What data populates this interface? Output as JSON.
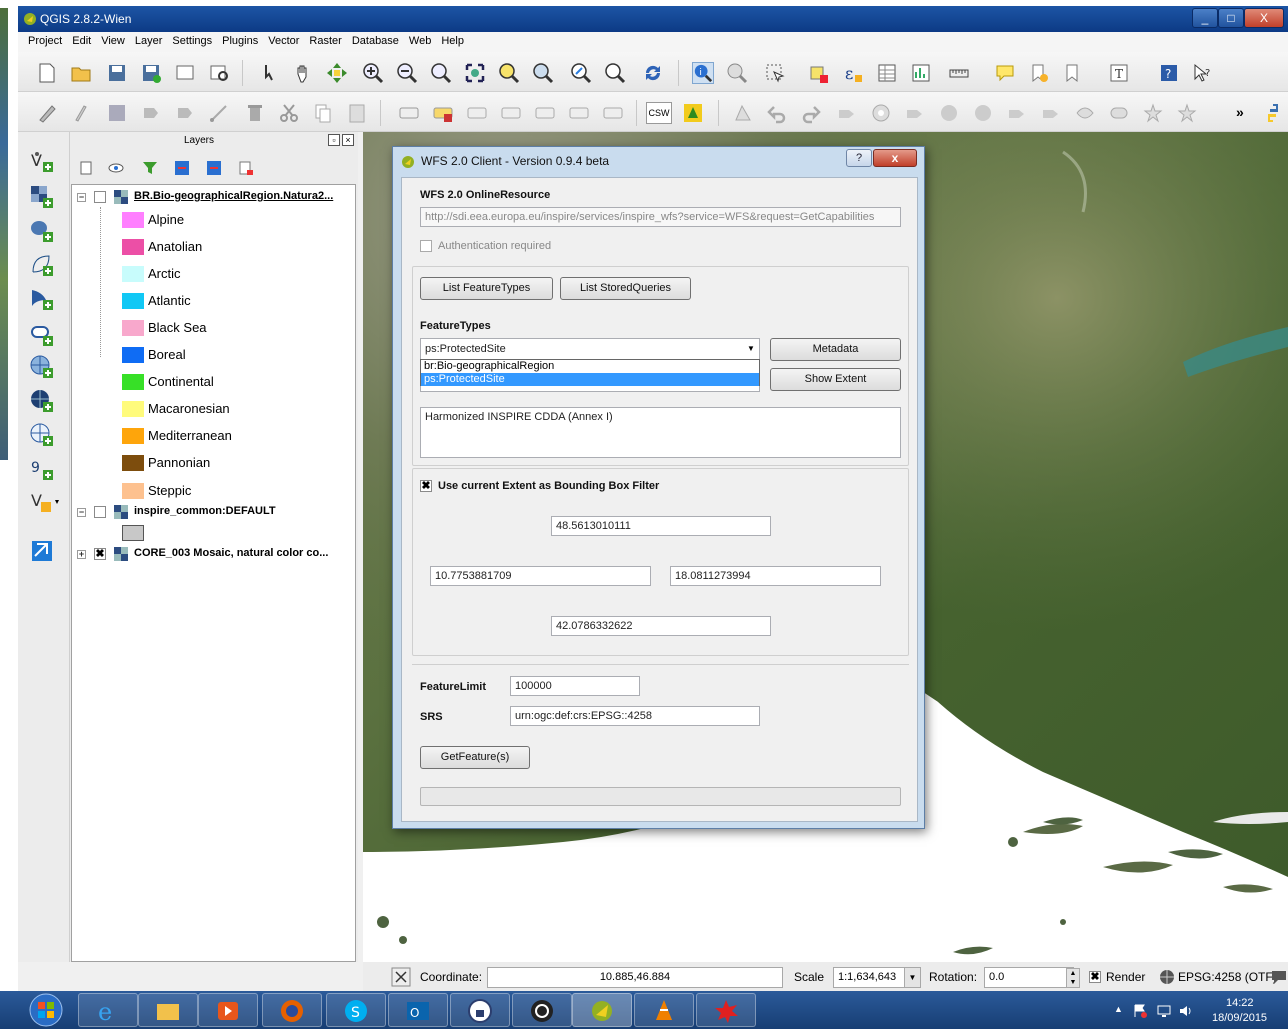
{
  "window": {
    "title": "QGIS 2.8.2-Wien",
    "min": "_",
    "max": "□",
    "close": "X"
  },
  "menu": [
    "Project",
    "Edit",
    "View",
    "Layer",
    "Settings",
    "Plugins",
    "Vector",
    "Raster",
    "Database",
    "Web",
    "Help"
  ],
  "toolbar2": {
    "csw_label": "CSW",
    "more": "»"
  },
  "layers": {
    "title": "Layers",
    "float_btn": "▫",
    "close_btn": "×",
    "groups": [
      {
        "name": "BR.Bio-geographicalRegion.Natura2...",
        "checked": false,
        "classes": [
          {
            "label": "Alpine",
            "color": "#ff7fff"
          },
          {
            "label": "Anatolian",
            "color": "#ec4fa6"
          },
          {
            "label": "Arctic",
            "color": "#c8fcfc"
          },
          {
            "label": "Atlantic",
            "color": "#11c8f5"
          },
          {
            "label": "Black Sea",
            "color": "#f8a8cc"
          },
          {
            "label": "Boreal",
            "color": "#0f6cf4"
          },
          {
            "label": "Continental",
            "color": "#37e027"
          },
          {
            "label": "Macaronesian",
            "color": "#fffb7c"
          },
          {
            "label": "Mediterranean",
            "color": "#fea50b"
          },
          {
            "label": "Pannonian",
            "color": "#7d4d0d"
          },
          {
            "label": "Steppic",
            "color": "#fdc18f"
          }
        ]
      },
      {
        "name": "inspire_common:DEFAULT",
        "checked": false,
        "classes": [
          {
            "label": "",
            "color": "#c8c8c8"
          }
        ]
      },
      {
        "name": "CORE_003 Mosaic, natural color co...",
        "checked": true
      }
    ]
  },
  "dialog": {
    "title": "WFS 2.0 Client - Version 0.9.4 beta",
    "help_btn": "?",
    "close_btn": "x",
    "online_resource_label": "WFS 2.0 OnlineResource",
    "online_resource_value": "http://sdi.eea.europa.eu/inspire/services/inspire_wfs?service=WFS&request=GetCapabilities",
    "auth_label": "Authentication required",
    "list_feature_types": "List FeatureTypes",
    "list_stored_queries": "List StoredQueries",
    "feature_types_label": "FeatureTypes",
    "selected_feature_type": "ps:ProtectedSite",
    "feature_type_options": [
      "br:Bio-geographicalRegion",
      "ps:ProtectedSite"
    ],
    "metadata_btn": "Metadata",
    "show_extent_btn": "Show Extent",
    "abstract": "Harmonized INSPIRE CDDA (Annex I)",
    "bbox_check_mark": "✖",
    "bbox_label": "Use current Extent as Bounding Box Filter",
    "bbox_north": "48.5613010111",
    "bbox_west": "10.7753881709",
    "bbox_east": "18.0811273994",
    "bbox_south": "42.0786332622",
    "feature_limit_label": "FeatureLimit",
    "feature_limit_value": "100000",
    "srs_label": "SRS",
    "srs_value": "urn:ogc:def:crs:EPSG::4258",
    "get_feature_btn": "GetFeature(s)"
  },
  "status": {
    "coordinate_label": "Coordinate:",
    "coordinate_value": "10.885,46.884",
    "scale_label": "Scale",
    "scale_value": "1:1,634,643",
    "rotation_label": "Rotation:",
    "rotation_value": "0.0",
    "render_check_mark": "✖",
    "render_label": "Render",
    "crs_label": "EPSG:4258 (OTF)"
  },
  "taskbar": {
    "time": "14:22",
    "date": "18/09/2015",
    "tray_arrow": "▲"
  }
}
